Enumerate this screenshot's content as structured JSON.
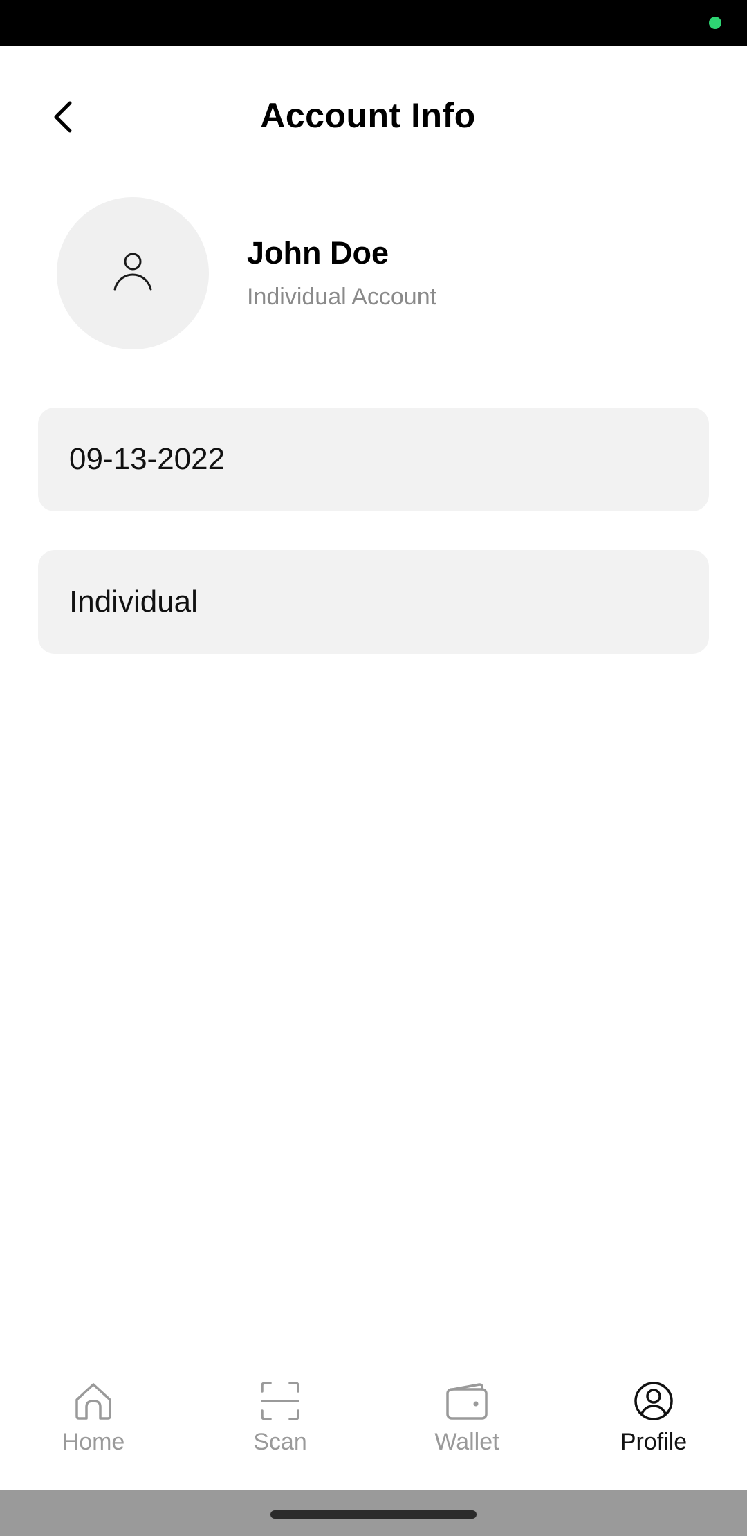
{
  "header": {
    "title": "Account Info",
    "back_icon": "chevron-left-icon"
  },
  "profile": {
    "avatar_icon": "user-icon",
    "name": "John Doe",
    "subtitle": "Individual Account"
  },
  "fields": [
    {
      "value": "09-13-2022"
    },
    {
      "value": "Individual"
    }
  ],
  "bottom_nav": {
    "items": [
      {
        "label": "Home",
        "icon": "home-icon",
        "active": false
      },
      {
        "label": "Scan",
        "icon": "scan-icon",
        "active": false
      },
      {
        "label": "Wallet",
        "icon": "wallet-icon",
        "active": false
      },
      {
        "label": "Profile",
        "icon": "profile-icon",
        "active": true
      }
    ]
  },
  "colors": {
    "status_indicator": "#2ed573",
    "field_background": "#f2f2f2",
    "avatar_background": "#f0f0f0",
    "inactive_nav": "#9a9a9a",
    "active_nav": "#111111"
  }
}
